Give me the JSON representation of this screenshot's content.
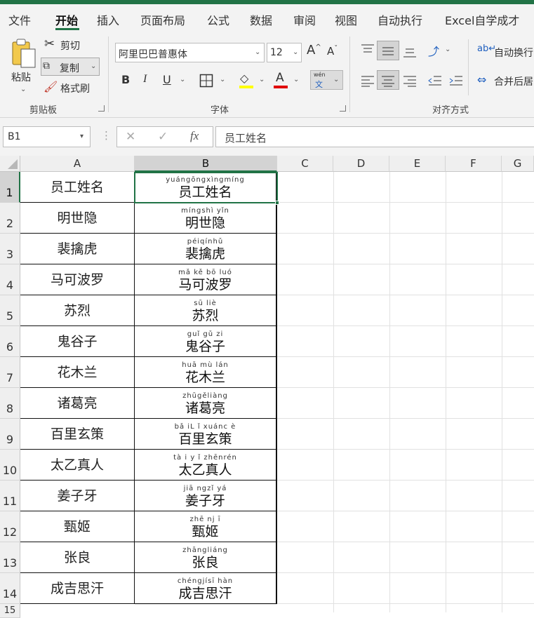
{
  "tabs": [
    "文件",
    "开始",
    "插入",
    "页面布局",
    "公式",
    "数据",
    "审阅",
    "视图",
    "自动执行",
    "Excel自学成才"
  ],
  "active_tab": "开始",
  "clipboard": {
    "paste": "粘贴",
    "cut": "剪切",
    "copy": "复制",
    "painter": "格式刷",
    "group": "剪贴板"
  },
  "font": {
    "name": "阿里巴巴普惠体",
    "size": "12",
    "grow": "A",
    "shrink": "A",
    "bold": "B",
    "italic": "I",
    "underline": "U",
    "phonetic_top": "wén",
    "phonetic_bottom": "文",
    "group": "字体"
  },
  "alignment": {
    "wrap": "自动换行",
    "merge": "合并后居",
    "group": "对齐方式"
  },
  "formula_bar": {
    "name_box": "B1",
    "fx": "fx",
    "content": "员工姓名"
  },
  "colors": {
    "accent": "#217346",
    "highlight": "#ffff00",
    "font_color": "#e00000"
  },
  "columns": [
    "A",
    "B",
    "C",
    "D",
    "E",
    "F",
    "G"
  ],
  "rows": [
    {
      "num": "1",
      "a": "员工姓名",
      "py": "yuángōngxìngmíng",
      "b": "员工姓名"
    },
    {
      "num": "2",
      "a": "明世隐",
      "py": "míngshì yǐn",
      "b": "明世隐"
    },
    {
      "num": "3",
      "a": "裴擒虎",
      "py": "péiqínhǔ",
      "b": "裴擒虎"
    },
    {
      "num": "4",
      "a": "马可波罗",
      "py": "mǎ kě bō luó",
      "b": "马可波罗"
    },
    {
      "num": "5",
      "a": "苏烈",
      "py": "sū liè",
      "b": "苏烈"
    },
    {
      "num": "6",
      "a": "鬼谷子",
      "py": "guǐ gǔ zi",
      "b": "鬼谷子"
    },
    {
      "num": "7",
      "a": "花木兰",
      "py": "huā mù lán",
      "b": "花木兰"
    },
    {
      "num": "8",
      "a": "诸葛亮",
      "py": "zhūgěliàng",
      "b": "诸葛亮"
    },
    {
      "num": "9",
      "a": "百里玄策",
      "py": "bǎ iL ǐ xuánc è",
      "b": "百里玄策"
    },
    {
      "num": "10",
      "a": "太乙真人",
      "py": "tà i y ǐ zhēnrén",
      "b": "太乙真人"
    },
    {
      "num": "11",
      "a": "姜子牙",
      "py": "jiā ngzǐ yá",
      "b": "姜子牙"
    },
    {
      "num": "12",
      "a": "甄姬",
      "py": "zhē nj ī",
      "b": "甄姬"
    },
    {
      "num": "13",
      "a": "张良",
      "py": "zhāngliáng",
      "b": "张良"
    },
    {
      "num": "14",
      "a": "成吉思汗",
      "py": "chéngjísī hàn",
      "b": "成吉思汗"
    }
  ],
  "partial_row": "15"
}
